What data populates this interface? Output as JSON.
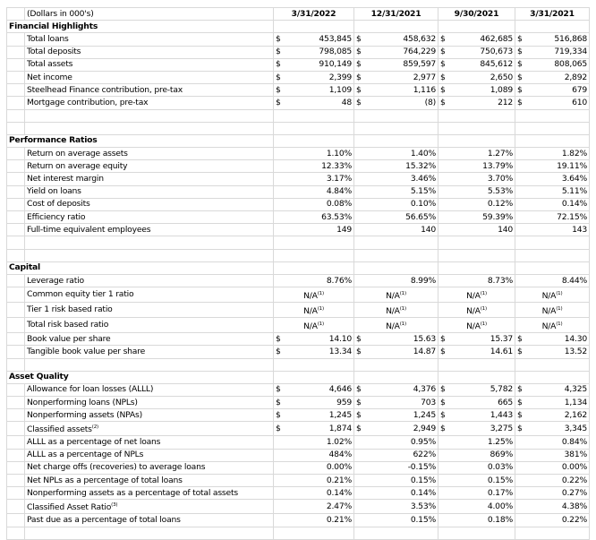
{
  "header": {
    "units": "(Dollars in 000's)",
    "periods": [
      "3/31/2022",
      "12/31/2021",
      "9/30/2021",
      "3/31/2021"
    ]
  },
  "sections": {
    "financial": {
      "title": "Financial Highlights",
      "rows": [
        {
          "label": "Total loans",
          "currency": "$",
          "values": [
            "453,845",
            "458,632",
            "462,685",
            "516,868"
          ]
        },
        {
          "label": "Total deposits",
          "currency": "$",
          "values": [
            "798,085",
            "764,229",
            "750,673",
            "719,334"
          ]
        },
        {
          "label": "Total assets",
          "currency": "$",
          "values": [
            "910,149",
            "859,597",
            "845,612",
            "808,065"
          ]
        },
        {
          "label": "Net income",
          "currency": "$",
          "values": [
            "2,399",
            "2,977",
            "2,650",
            "2,892"
          ]
        },
        {
          "label": "Steelhead Finance contribution, pre-tax",
          "currency": "$",
          "values": [
            "1,109",
            "1,116",
            "1,089",
            "679"
          ]
        },
        {
          "label": "Mortgage contribution, pre-tax",
          "currency": "$",
          "values": [
            "48",
            "(8)",
            "212",
            "610"
          ]
        }
      ]
    },
    "performance": {
      "title": "Performance Ratios",
      "rows": [
        {
          "label": "Return on average assets",
          "values": [
            "1.10%",
            "1.40%",
            "1.27%",
            "1.82%"
          ]
        },
        {
          "label": "Return on average equity",
          "values": [
            "12.33%",
            "15.32%",
            "13.79%",
            "19.11%"
          ]
        },
        {
          "label": "Net interest margin",
          "values": [
            "3.17%",
            "3.46%",
            "3.70%",
            "3.64%"
          ]
        },
        {
          "label": "Yield on loans",
          "values": [
            "4.84%",
            "5.15%",
            "5.53%",
            "5.11%"
          ]
        },
        {
          "label": "Cost of deposits",
          "values": [
            "0.08%",
            "0.10%",
            "0.12%",
            "0.14%"
          ]
        },
        {
          "label": "Efficiency ratio",
          "values": [
            "63.53%",
            "56.65%",
            "59.39%",
            "72.15%"
          ]
        },
        {
          "label": "Full-time equivalent employees",
          "values": [
            "149",
            "140",
            "140",
            "143"
          ]
        }
      ]
    },
    "capital": {
      "title": "Capital",
      "leverage": {
        "label": "Leverage ratio",
        "values": [
          "8.76%",
          "8.99%",
          "8.73%",
          "8.44%"
        ]
      },
      "na_rows": [
        {
          "label": "Common equity tier 1 ratio",
          "value": "N/A",
          "note": "(1)"
        },
        {
          "label": "Tier 1 risk based ratio",
          "value": "N/A",
          "note": "(1)"
        },
        {
          "label": "Total risk based ratio",
          "value": "N/A",
          "note": "(1)"
        }
      ],
      "currency_rows": [
        {
          "label": "Book value per share",
          "currency": "$",
          "values": [
            "14.10",
            "15.63",
            "15.37",
            "14.30"
          ]
        },
        {
          "label": "Tangible book value per share",
          "currency": "$",
          "values": [
            "13.34",
            "14.87",
            "14.61",
            "13.52"
          ]
        }
      ]
    },
    "asset_quality": {
      "title": "Asset Quality",
      "currency_rows": [
        {
          "label": "Allowance for loan losses (ALLL)",
          "note": "",
          "currency": "$",
          "values": [
            "4,646",
            "4,376",
            "5,782",
            "4,325"
          ]
        },
        {
          "label": "Nonperforming loans (NPLs)",
          "note": "",
          "currency": "$",
          "values": [
            "959",
            "703",
            "665",
            "1,134"
          ]
        },
        {
          "label": "Nonperforming assets (NPAs)",
          "note": "",
          "currency": "$",
          "values": [
            "1,245",
            "1,245",
            "1,443",
            "2,162"
          ]
        },
        {
          "label": "Classified assets",
          "note": "(2)",
          "currency": "$",
          "values": [
            "1,874",
            "2,949",
            "3,275",
            "3,345"
          ]
        }
      ],
      "pct_rows": [
        {
          "label": "ALLL as a percentage of net loans",
          "note": "",
          "values": [
            "1.02%",
            "0.95%",
            "1.25%",
            "0.84%"
          ]
        },
        {
          "label": "ALLL as a percentage of NPLs",
          "note": "",
          "values": [
            "484%",
            "622%",
            "869%",
            "381%"
          ]
        },
        {
          "label": "Net charge offs (recoveries) to average loans",
          "note": "",
          "values": [
            "0.00%",
            "-0.15%",
            "0.03%",
            "0.00%"
          ]
        },
        {
          "label": "Net NPLs as a percentage of total loans",
          "note": "",
          "values": [
            "0.21%",
            "0.15%",
            "0.15%",
            "0.22%"
          ]
        },
        {
          "label": "Nonperforming assets as a percentage of total assets",
          "note": "",
          "values": [
            "0.14%",
            "0.14%",
            "0.17%",
            "0.27%"
          ]
        },
        {
          "label": "Classified Asset Ratio",
          "note": "(3)",
          "values": [
            "2.47%",
            "3.53%",
            "4.00%",
            "4.38%"
          ]
        },
        {
          "label": "Past due as a percentage of total loans",
          "note": "",
          "values": [
            "0.21%",
            "0.15%",
            "0.18%",
            "0.22%"
          ]
        }
      ]
    }
  }
}
